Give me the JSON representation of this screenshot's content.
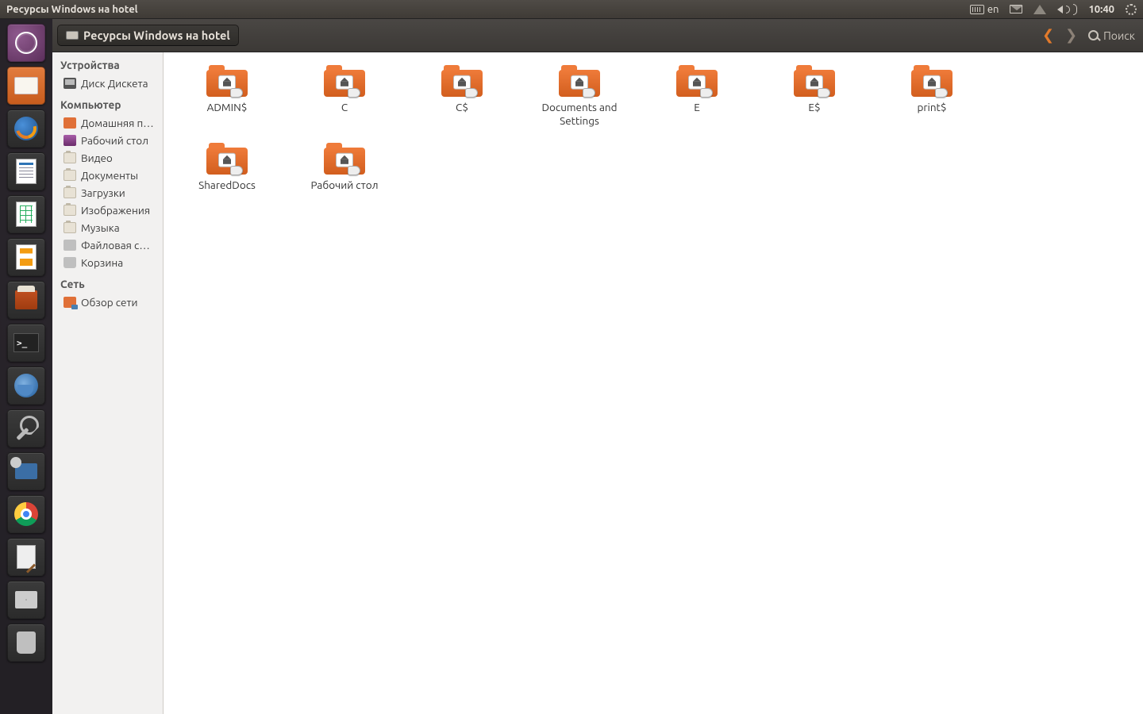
{
  "panel": {
    "app_title": "Ресурсы Windows на hotel",
    "lang": "en",
    "time": "10:40"
  },
  "toolbar": {
    "location": "Ресурсы Windows на hotel",
    "search_label": "Поиск"
  },
  "sidebar": {
    "devices_header": "Устройства",
    "devices": [
      {
        "label": "Диск Дискета",
        "icon": "disk"
      }
    ],
    "computer_header": "Компьютер",
    "computer": [
      {
        "label": "Домашняя п…",
        "icon": "home"
      },
      {
        "label": "Рабочий стол",
        "icon": "desktop"
      },
      {
        "label": "Видео",
        "icon": "generic"
      },
      {
        "label": "Документы",
        "icon": "generic"
      },
      {
        "label": "Загрузки",
        "icon": "generic"
      },
      {
        "label": "Изображения",
        "icon": "generic"
      },
      {
        "label": "Музыка",
        "icon": "generic"
      },
      {
        "label": "Файловая с…",
        "icon": "fs"
      },
      {
        "label": "Корзина",
        "icon": "trash"
      }
    ],
    "network_header": "Сеть",
    "network": [
      {
        "label": "Обзор сети",
        "icon": "net"
      }
    ]
  },
  "folders": [
    {
      "name": "ADMIN$"
    },
    {
      "name": "C"
    },
    {
      "name": "C$"
    },
    {
      "name": "Documents and Settings"
    },
    {
      "name": "E"
    },
    {
      "name": "E$"
    },
    {
      "name": "print$"
    },
    {
      "name": "SharedDocs"
    },
    {
      "name": "Рабочий стол"
    }
  ],
  "launcher": [
    {
      "id": "dash",
      "kind": "purple"
    },
    {
      "id": "files",
      "kind": "active",
      "glyph": "inner-folder"
    },
    {
      "id": "firefox",
      "glyph": "ff"
    },
    {
      "id": "writer",
      "glyph": "doc blue"
    },
    {
      "id": "calc",
      "glyph": "doc green"
    },
    {
      "id": "impress",
      "glyph": "doc orange"
    },
    {
      "id": "software",
      "glyph": "sw"
    },
    {
      "id": "terminal",
      "glyph": "term"
    },
    {
      "id": "thunderbird",
      "glyph": "tb"
    },
    {
      "id": "settings",
      "glyph": "wrench"
    },
    {
      "id": "remote",
      "glyph": "remote"
    },
    {
      "id": "chrome",
      "glyph": "chrome"
    },
    {
      "id": "gedit",
      "glyph": "note"
    },
    {
      "id": "workspaces",
      "glyph": "ws"
    },
    {
      "id": "trash",
      "glyph": "trash"
    }
  ]
}
